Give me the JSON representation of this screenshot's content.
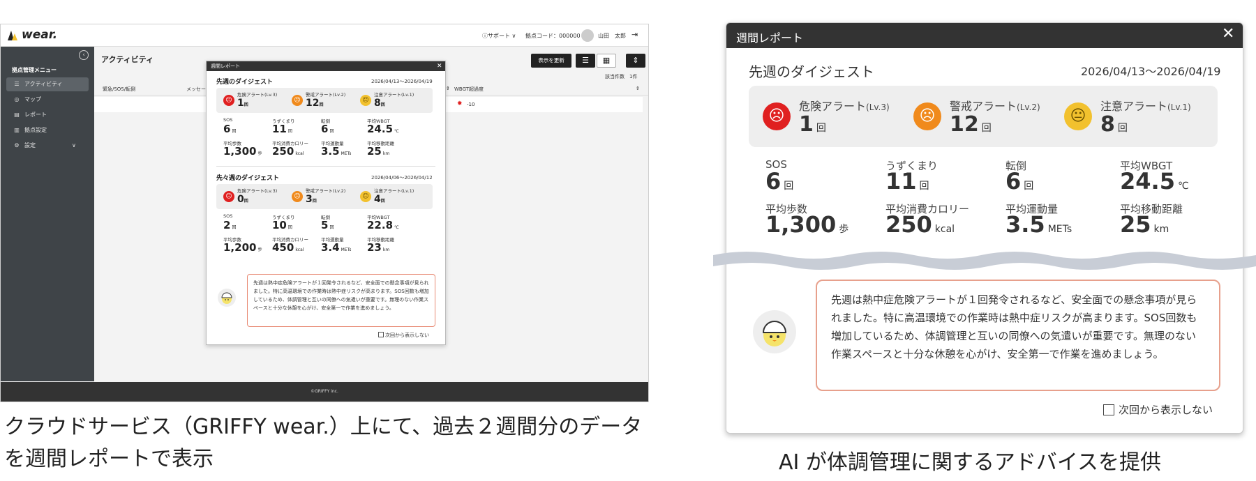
{
  "app": {
    "logo_text": "wear.",
    "support_label": "サポート",
    "site_code": "拠点コード：000000",
    "user_name": "山田　太郎"
  },
  "sidebar": {
    "title": "拠点管理メニュー",
    "items": [
      {
        "label": "アクティビティ",
        "icon": "list-icon"
      },
      {
        "label": "マップ",
        "icon": "pin-icon"
      },
      {
        "label": "レポート",
        "icon": "report-icon"
      },
      {
        "label": "拠点設定",
        "icon": "building-icon"
      },
      {
        "label": "設定",
        "icon": "gear-icon"
      }
    ]
  },
  "activity": {
    "title": "アクティビティ",
    "refresh_button": "表示を更新",
    "count_label": "該当件数　1件",
    "columns": [
      "緊急/SOS/転倒",
      "メッセー",
      "WBGT超過度"
    ],
    "row_value": "-10"
  },
  "footer": {
    "copyright": "©GRIFFY inc."
  },
  "report": {
    "title": "週間レポート",
    "check_label": "次回から表示しない",
    "message": "先週は熱中症危険アラートが１回発令されるなど、安全面での懸念事項が見られました。特に高温環境での作業時は熱中症リスクが高まります。SOS回数も増加しているため、体調管理と互いの同僚への気遣いが重要です。無理のない作業スペースと十分な休憩を心がけ、安全第一で作業を進めましょう。",
    "alert_labels": {
      "danger": "危険アラート",
      "warning": "警戒アラート",
      "caution": "注意アラート"
    },
    "alert_levels": {
      "danger": "(Lv.3)",
      "warning": "(Lv.2)",
      "caution": "(Lv.1)"
    },
    "weeks": [
      {
        "title": "先週のダイジェスト",
        "date": "2026/04/13〜2026/04/19",
        "alerts": {
          "danger": "1",
          "warning": "12",
          "caution": "8"
        },
        "stats": {
          "sos": "6",
          "puddle": "11",
          "fall": "6",
          "wbgt": "24.5",
          "steps": "1,300",
          "calories": "250",
          "mets": "3.5",
          "distance": "25"
        }
      },
      {
        "title": "先々週のダイジェスト",
        "date": "2026/04/06〜2026/04/12",
        "alerts": {
          "danger": "0",
          "warning": "3",
          "caution": "4"
        },
        "stats": {
          "sos": "2",
          "puddle": "10",
          "fall": "5",
          "wbgt": "22.8",
          "steps": "1,200",
          "calories": "450",
          "mets": "3.4",
          "distance": "23"
        }
      }
    ],
    "stat_labels": {
      "sos": "SOS",
      "puddle": "うずくまり",
      "fall": "転倒",
      "wbgt": "平均WBGT",
      "steps": "平均歩数",
      "calories": "平均消費カロリー",
      "mets": "平均運動量",
      "distance": "平均移動距離"
    },
    "units": {
      "count": "回",
      "temp": "℃",
      "steps": "歩",
      "kcal": "kcal",
      "mets": "METs",
      "km": "km"
    }
  },
  "captions": {
    "left": "クラウドサービス（GRIFFY wear.）上にて、過去２週間分のデータを週間レポートで表示",
    "right": "AI が体調管理に関するアドバイスを提供"
  },
  "colors": {
    "danger": "#e02020",
    "warning": "#f08a1c",
    "caution": "#f2c12e",
    "header": "#333333",
    "sidebar": "#3f4448"
  }
}
